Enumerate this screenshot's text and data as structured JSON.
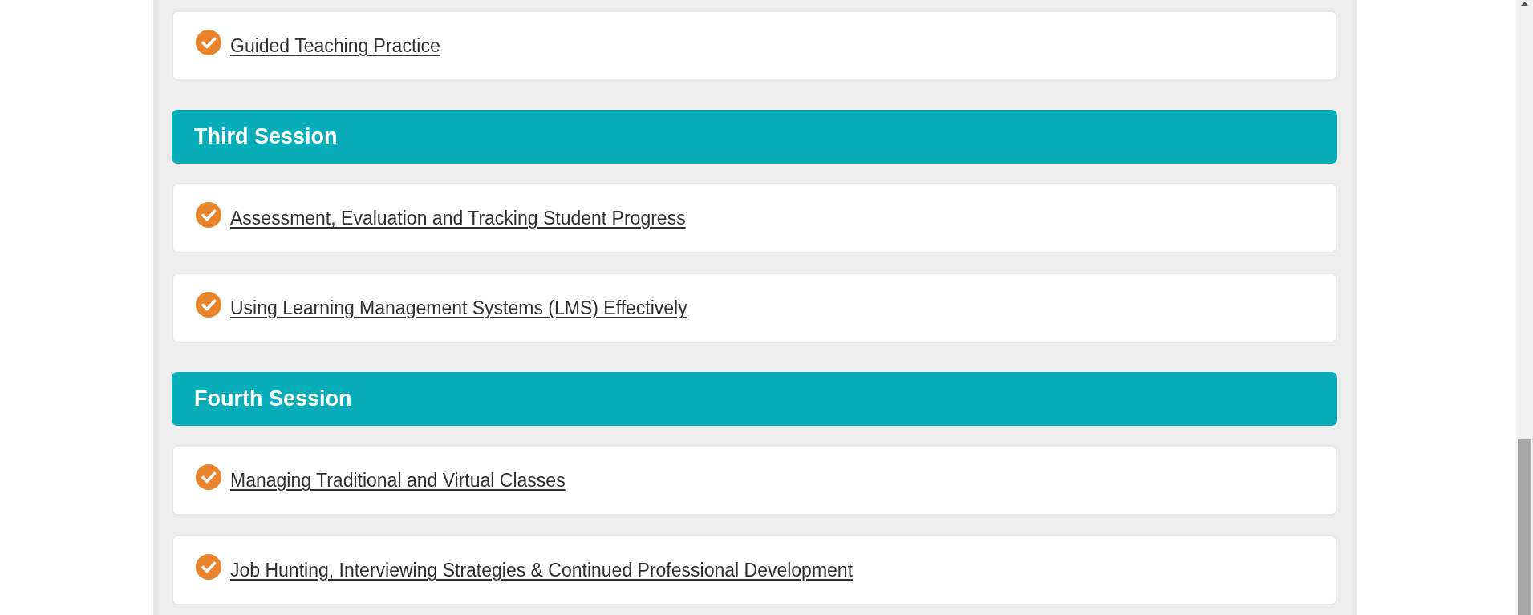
{
  "sessions": [
    {
      "lessons": [
        {
          "title": "Guided Teaching Practice"
        }
      ]
    },
    {
      "title": "Third Session",
      "lessons": [
        {
          "title": "Assessment, Evaluation and Tracking Student Progress"
        },
        {
          "title": "Using Learning Management Systems (LMS) Effectively"
        }
      ]
    },
    {
      "title": "Fourth Session",
      "lessons": [
        {
          "title": "Managing Traditional and Virtual Classes"
        },
        {
          "title": "Job Hunting, Interviewing Strategies & Continued Professional Development"
        }
      ]
    }
  ]
}
